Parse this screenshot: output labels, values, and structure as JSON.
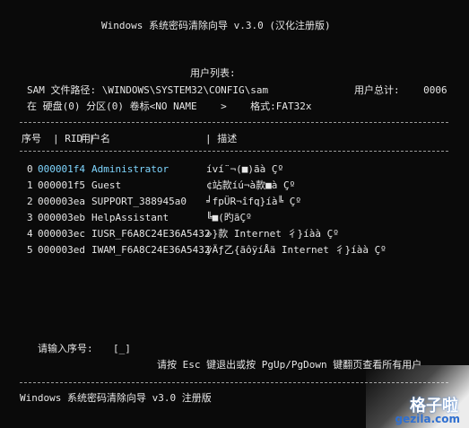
{
  "app": {
    "title": "Windows 系统密码清除向导 v.3.0 (汉化注册版)",
    "footer": "Windows 系统密码清除向导 v3.0 注册版"
  },
  "header": {
    "heading": "用户列表:",
    "sam_path": "SAM 文件路径: \\WINDOWS\\SYSTEM32\\CONFIG\\sam",
    "total_label": "用户总计:",
    "total_value": "0006",
    "disk_info": "在 硬盘(0) 分区(0) 卷标<NO NAME    >    格式:FAT32x"
  },
  "table": {
    "columns": [
      "序号",
      "RID",
      "用户名",
      "描述"
    ],
    "rows": [
      {
        "index": "0",
        "rid": "000001f4",
        "name": "Administrator",
        "desc": "íví¨¬(■)ãà Çº"
      },
      {
        "index": "1",
        "rid": "000001f5",
        "name": "Guest",
        "desc": "¢站款íú¬à款■à Çº"
      },
      {
        "index": "2",
        "rid": "000003ea",
        "name": "SUPPORT_388945a0",
        "desc": "╛fpÜR¬îfq}íà╚ Çº"
      },
      {
        "index": "3",
        "rid": "000003eb",
        "name": "HelpAssistant",
        "desc": "╚■(旳ãÇº"
      },
      {
        "index": "4",
        "rid": "000003ec",
        "name": "IUSR_F6A8C24E36A5432",
        "desc": "»}款 Internet 彳}íàà Çº"
      },
      {
        "index": "5",
        "rid": "000003ed",
        "name": "IWAM_F6A8C24E36A5432",
        "desc": "ÿÄƒ乙{ãôÿíÅä Internet 彳}íàà Çº"
      }
    ]
  },
  "prompt": {
    "label": "请输入序号:",
    "value": "[_]"
  },
  "hint": "请按 Esc 键退出或按 PgUp/PgDown 键翻页查看所有用户",
  "watermark": {
    "logo": "格子啦",
    "site": "gezila.com"
  }
}
